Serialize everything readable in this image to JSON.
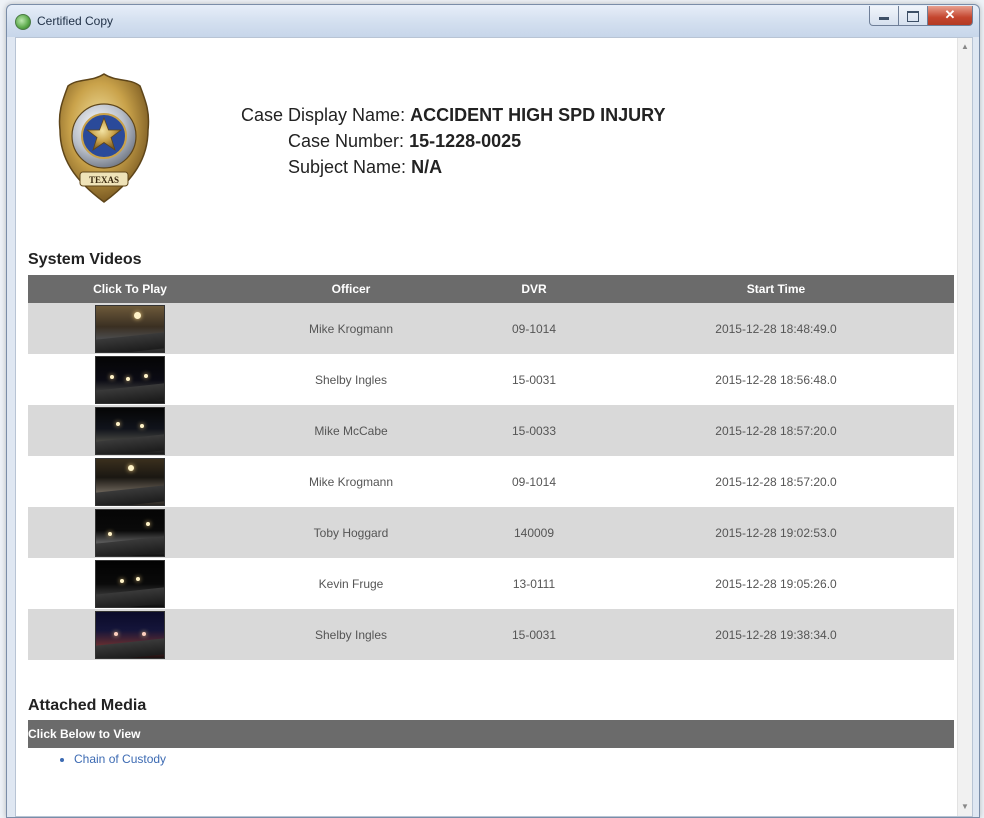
{
  "window": {
    "title": "Certified Copy"
  },
  "case": {
    "display_name_label": "Case Display Name:",
    "display_name_value": "ACCIDENT HIGH SPD INJURY",
    "number_label": "Case Number:",
    "number_value": "15-1228-0025",
    "subject_label": "Subject Name:",
    "subject_value": "N/A"
  },
  "badge": {
    "state_text": "TEXAS"
  },
  "system_videos": {
    "title": "System Videos",
    "columns": [
      "Click To Play",
      "Officer",
      "DVR",
      "Start Time"
    ],
    "rows": [
      {
        "officer": "Mike Krogmann",
        "dvr": "09-1014",
        "start_time": "2015-12-28 18:48:49.0"
      },
      {
        "officer": "Shelby Ingles",
        "dvr": "15-0031",
        "start_time": "2015-12-28 18:56:48.0"
      },
      {
        "officer": "Mike McCabe",
        "dvr": "15-0033",
        "start_time": "2015-12-28 18:57:20.0"
      },
      {
        "officer": "Mike Krogmann",
        "dvr": "09-1014",
        "start_time": "2015-12-28 18:57:20.0"
      },
      {
        "officer": "Toby Hoggard",
        "dvr": "140009",
        "start_time": "2015-12-28 19:02:53.0"
      },
      {
        "officer": "Kevin Fruge",
        "dvr": "13-0111",
        "start_time": "2015-12-28 19:05:26.0"
      },
      {
        "officer": "Shelby Ingles",
        "dvr": "15-0031",
        "start_time": "2015-12-28 19:38:34.0"
      }
    ]
  },
  "attached_media": {
    "title": "Attached Media",
    "bar_label": "Click Below to View",
    "items": [
      "Chain of Custody"
    ]
  },
  "colors": {
    "header_bar": "#6b6b6b",
    "row_shaded": "#d9d9d9",
    "link": "#3d6bb3"
  },
  "icons": {
    "app": "certified-copy-app-icon",
    "badge": "police-badge-icon"
  }
}
